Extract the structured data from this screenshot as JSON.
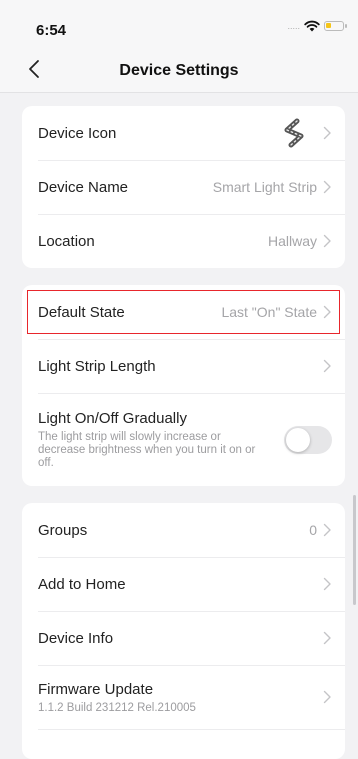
{
  "status": {
    "time": "6:54",
    "dots": "....."
  },
  "nav": {
    "title": "Device Settings"
  },
  "section1": {
    "device_icon_label": "Device Icon",
    "device_name_label": "Device Name",
    "device_name_value": "Smart Light Strip",
    "location_label": "Location",
    "location_value": "Hallway"
  },
  "section2": {
    "default_state_label": "Default State",
    "default_state_value": "Last \"On\" State",
    "strip_length_label": "Light Strip Length",
    "gradual_label": "Light On/Off Gradually",
    "gradual_desc": "The light strip will slowly increase or decrease brightness when you turn it on or off.",
    "gradual_enabled": false
  },
  "section3": {
    "groups_label": "Groups",
    "groups_value": "0",
    "add_home_label": "Add to Home",
    "device_info_label": "Device Info",
    "firmware_label": "Firmware Update",
    "firmware_version": "1.1.2 Build 231212 Rel.210005"
  },
  "colors": {
    "highlight": "#e8262c",
    "battery": "#f5c518"
  }
}
